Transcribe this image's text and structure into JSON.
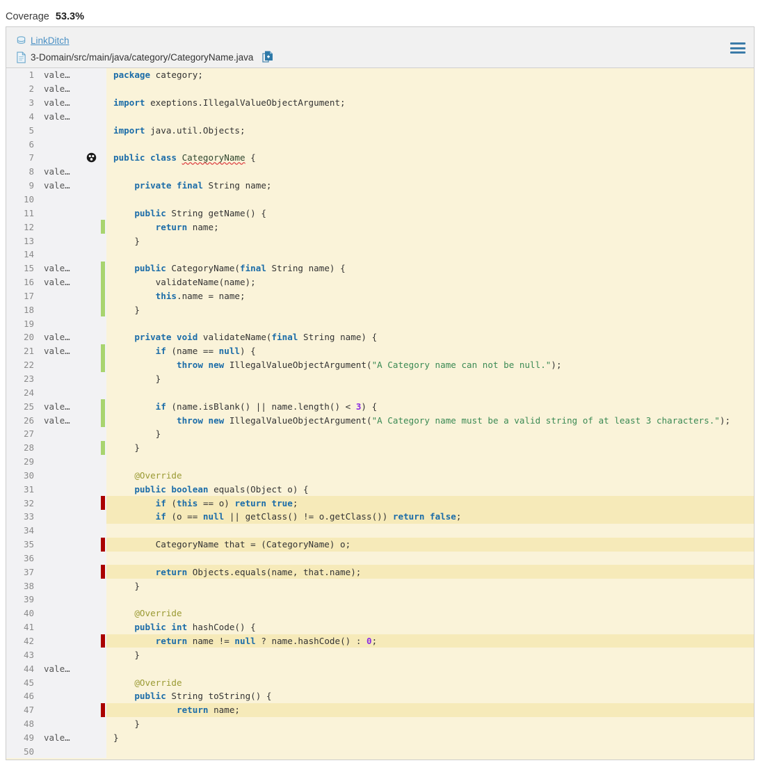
{
  "header": {
    "coverage_label": "Coverage",
    "coverage_value": "53.3%"
  },
  "breadcrumb": {
    "project_icon": "database-icon",
    "project": "LinkDitch",
    "file_icon": "file-icon",
    "file_path": "3-Domain/src/main/java/category/CategoryName.java",
    "copy_icon": "copy-file-icon"
  },
  "toolbar": {
    "menu_icon": "hamburger-menu-icon"
  },
  "editor": {
    "blame_truncated": "vale…",
    "marker_icon": "bug-marker-icon",
    "colors": {
      "covered": "#a8d46f",
      "uncovered": "#aa0000",
      "code_bg": "#faf3d9",
      "uncovered_row_bg": "#f6eab9",
      "gutter_bg": "#f2f2f4",
      "keyword": "#1b6ca8",
      "string": "#3b8a54",
      "number": "#8a2be2",
      "annotation": "#9a9a33",
      "link": "#4a90c4"
    },
    "lines": [
      {
        "n": 1,
        "blame": "vale…",
        "cov": "none",
        "marker": false,
        "uncovered": false,
        "tokens": [
          {
            "t": "package",
            "c": "kw"
          },
          {
            "t": " category;",
            "c": "pl"
          }
        ]
      },
      {
        "n": 2,
        "blame": "vale…",
        "cov": "none",
        "marker": false,
        "uncovered": false,
        "tokens": []
      },
      {
        "n": 3,
        "blame": "vale…",
        "cov": "none",
        "marker": false,
        "uncovered": false,
        "tokens": [
          {
            "t": "import",
            "c": "kw"
          },
          {
            "t": " exeptions.IllegalValueObjectArgument;",
            "c": "pl"
          }
        ]
      },
      {
        "n": 4,
        "blame": "vale…",
        "cov": "none",
        "marker": false,
        "uncovered": false,
        "tokens": []
      },
      {
        "n": 5,
        "blame": "",
        "cov": "none",
        "marker": false,
        "uncovered": false,
        "tokens": [
          {
            "t": "import",
            "c": "kw"
          },
          {
            "t": " java.util.Objects;",
            "c": "pl"
          }
        ]
      },
      {
        "n": 6,
        "blame": "",
        "cov": "none",
        "marker": false,
        "uncovered": false,
        "tokens": []
      },
      {
        "n": 7,
        "blame": "",
        "cov": "none",
        "marker": true,
        "uncovered": false,
        "tokens": [
          {
            "t": "public class",
            "c": "kw"
          },
          {
            "t": " ",
            "c": "pl"
          },
          {
            "t": "CategoryName",
            "c": "err"
          },
          {
            "t": " {",
            "c": "pl"
          }
        ]
      },
      {
        "n": 8,
        "blame": "vale…",
        "cov": "none",
        "marker": false,
        "uncovered": false,
        "tokens": []
      },
      {
        "n": 9,
        "blame": "vale…",
        "cov": "none",
        "marker": false,
        "uncovered": false,
        "tokens": [
          {
            "t": "    ",
            "c": "pl"
          },
          {
            "t": "private final",
            "c": "kw"
          },
          {
            "t": " String name;",
            "c": "pl"
          }
        ]
      },
      {
        "n": 10,
        "blame": "",
        "cov": "none",
        "marker": false,
        "uncovered": false,
        "tokens": []
      },
      {
        "n": 11,
        "blame": "",
        "cov": "none",
        "marker": false,
        "uncovered": false,
        "tokens": [
          {
            "t": "    ",
            "c": "pl"
          },
          {
            "t": "public",
            "c": "kw"
          },
          {
            "t": " String getName() {",
            "c": "pl"
          }
        ]
      },
      {
        "n": 12,
        "blame": "",
        "cov": "green",
        "marker": false,
        "uncovered": false,
        "tokens": [
          {
            "t": "        ",
            "c": "pl"
          },
          {
            "t": "return",
            "c": "kw"
          },
          {
            "t": " name;",
            "c": "pl"
          }
        ]
      },
      {
        "n": 13,
        "blame": "",
        "cov": "none",
        "marker": false,
        "uncovered": false,
        "tokens": [
          {
            "t": "    }",
            "c": "pl"
          }
        ]
      },
      {
        "n": 14,
        "blame": "",
        "cov": "none",
        "marker": false,
        "uncovered": false,
        "tokens": []
      },
      {
        "n": 15,
        "blame": "vale…",
        "cov": "green",
        "marker": false,
        "uncovered": false,
        "tokens": [
          {
            "t": "    ",
            "c": "pl"
          },
          {
            "t": "public",
            "c": "kw"
          },
          {
            "t": " CategoryName(",
            "c": "pl"
          },
          {
            "t": "final",
            "c": "kw"
          },
          {
            "t": " String name) {",
            "c": "pl"
          }
        ]
      },
      {
        "n": 16,
        "blame": "vale…",
        "cov": "green",
        "marker": false,
        "uncovered": false,
        "tokens": [
          {
            "t": "        validateName(name);",
            "c": "pl"
          }
        ]
      },
      {
        "n": 17,
        "blame": "",
        "cov": "green",
        "marker": false,
        "uncovered": false,
        "tokens": [
          {
            "t": "        ",
            "c": "pl"
          },
          {
            "t": "this",
            "c": "kw"
          },
          {
            "t": ".name = name;",
            "c": "pl"
          }
        ]
      },
      {
        "n": 18,
        "blame": "",
        "cov": "green",
        "marker": false,
        "uncovered": false,
        "tokens": [
          {
            "t": "    }",
            "c": "pl"
          }
        ]
      },
      {
        "n": 19,
        "blame": "",
        "cov": "none",
        "marker": false,
        "uncovered": false,
        "tokens": []
      },
      {
        "n": 20,
        "blame": "vale…",
        "cov": "none",
        "marker": false,
        "uncovered": false,
        "tokens": [
          {
            "t": "    ",
            "c": "pl"
          },
          {
            "t": "private void",
            "c": "kw"
          },
          {
            "t": " validateName(",
            "c": "pl"
          },
          {
            "t": "final",
            "c": "kw"
          },
          {
            "t": " String name) {",
            "c": "pl"
          }
        ]
      },
      {
        "n": 21,
        "blame": "vale…",
        "cov": "green",
        "marker": false,
        "uncovered": false,
        "tokens": [
          {
            "t": "        ",
            "c": "pl"
          },
          {
            "t": "if",
            "c": "kw"
          },
          {
            "t": " (name == ",
            "c": "pl"
          },
          {
            "t": "null",
            "c": "kw"
          },
          {
            "t": ") {",
            "c": "pl"
          }
        ]
      },
      {
        "n": 22,
        "blame": "",
        "cov": "green",
        "marker": false,
        "uncovered": false,
        "tokens": [
          {
            "t": "            ",
            "c": "pl"
          },
          {
            "t": "throw new",
            "c": "kw"
          },
          {
            "t": " IllegalValueObjectArgument(",
            "c": "pl"
          },
          {
            "t": "\"A Category name can not be null.\"",
            "c": "str"
          },
          {
            "t": ");",
            "c": "pl"
          }
        ]
      },
      {
        "n": 23,
        "blame": "",
        "cov": "none",
        "marker": false,
        "uncovered": false,
        "tokens": [
          {
            "t": "        }",
            "c": "pl"
          }
        ]
      },
      {
        "n": 24,
        "blame": "",
        "cov": "none",
        "marker": false,
        "uncovered": false,
        "tokens": []
      },
      {
        "n": 25,
        "blame": "vale…",
        "cov": "green",
        "marker": false,
        "uncovered": false,
        "tokens": [
          {
            "t": "        ",
            "c": "pl"
          },
          {
            "t": "if",
            "c": "kw"
          },
          {
            "t": " (name.isBlank() || name.length() < ",
            "c": "pl"
          },
          {
            "t": "3",
            "c": "num"
          },
          {
            "t": ") {",
            "c": "pl"
          }
        ]
      },
      {
        "n": 26,
        "blame": "vale…",
        "cov": "green",
        "marker": false,
        "uncovered": false,
        "tokens": [
          {
            "t": "            ",
            "c": "pl"
          },
          {
            "t": "throw new",
            "c": "kw"
          },
          {
            "t": " IllegalValueObjectArgument(",
            "c": "pl"
          },
          {
            "t": "\"A Category name must be a valid string of at least 3 characters.\"",
            "c": "str"
          },
          {
            "t": ");",
            "c": "pl"
          }
        ]
      },
      {
        "n": 27,
        "blame": "",
        "cov": "none",
        "marker": false,
        "uncovered": false,
        "tokens": [
          {
            "t": "        }",
            "c": "pl"
          }
        ]
      },
      {
        "n": 28,
        "blame": "",
        "cov": "green",
        "marker": false,
        "uncovered": false,
        "tokens": [
          {
            "t": "    }",
            "c": "pl"
          }
        ]
      },
      {
        "n": 29,
        "blame": "",
        "cov": "none",
        "marker": false,
        "uncovered": false,
        "tokens": []
      },
      {
        "n": 30,
        "blame": "",
        "cov": "none",
        "marker": false,
        "uncovered": false,
        "tokens": [
          {
            "t": "    ",
            "c": "pl"
          },
          {
            "t": "@Override",
            "c": "ann"
          }
        ]
      },
      {
        "n": 31,
        "blame": "",
        "cov": "none",
        "marker": false,
        "uncovered": false,
        "tokens": [
          {
            "t": "    ",
            "c": "pl"
          },
          {
            "t": "public boolean",
            "c": "kw"
          },
          {
            "t": " equals(Object o) {",
            "c": "pl"
          }
        ]
      },
      {
        "n": 32,
        "blame": "",
        "cov": "red",
        "marker": false,
        "uncovered": true,
        "tokens": [
          {
            "t": "        ",
            "c": "pl"
          },
          {
            "t": "if",
            "c": "kw"
          },
          {
            "t": " (",
            "c": "pl"
          },
          {
            "t": "this",
            "c": "kw"
          },
          {
            "t": " == o) ",
            "c": "pl"
          },
          {
            "t": "return true",
            "c": "kw"
          },
          {
            "t": ";",
            "c": "pl"
          }
        ]
      },
      {
        "n": 33,
        "blame": "",
        "cov": "none",
        "marker": false,
        "uncovered": true,
        "tokens": [
          {
            "t": "        ",
            "c": "pl"
          },
          {
            "t": "if",
            "c": "kw"
          },
          {
            "t": " (o == ",
            "c": "pl"
          },
          {
            "t": "null",
            "c": "kw"
          },
          {
            "t": " || getClass() != o.getClass()) ",
            "c": "pl"
          },
          {
            "t": "return false",
            "c": "kw"
          },
          {
            "t": ";",
            "c": "pl"
          }
        ]
      },
      {
        "n": 34,
        "blame": "",
        "cov": "none",
        "marker": false,
        "uncovered": false,
        "tokens": []
      },
      {
        "n": 35,
        "blame": "",
        "cov": "red",
        "marker": false,
        "uncovered": true,
        "tokens": [
          {
            "t": "        CategoryName that = (CategoryName) o;",
            "c": "pl"
          }
        ]
      },
      {
        "n": 36,
        "blame": "",
        "cov": "none",
        "marker": false,
        "uncovered": false,
        "tokens": []
      },
      {
        "n": 37,
        "blame": "",
        "cov": "red",
        "marker": false,
        "uncovered": true,
        "tokens": [
          {
            "t": "        ",
            "c": "pl"
          },
          {
            "t": "return",
            "c": "kw"
          },
          {
            "t": " Objects.equals(name, that.name);",
            "c": "pl"
          }
        ]
      },
      {
        "n": 38,
        "blame": "",
        "cov": "none",
        "marker": false,
        "uncovered": false,
        "tokens": [
          {
            "t": "    }",
            "c": "pl"
          }
        ]
      },
      {
        "n": 39,
        "blame": "",
        "cov": "none",
        "marker": false,
        "uncovered": false,
        "tokens": []
      },
      {
        "n": 40,
        "blame": "",
        "cov": "none",
        "marker": false,
        "uncovered": false,
        "tokens": [
          {
            "t": "    ",
            "c": "pl"
          },
          {
            "t": "@Override",
            "c": "ann"
          }
        ]
      },
      {
        "n": 41,
        "blame": "",
        "cov": "none",
        "marker": false,
        "uncovered": false,
        "tokens": [
          {
            "t": "    ",
            "c": "pl"
          },
          {
            "t": "public int",
            "c": "kw"
          },
          {
            "t": " hashCode() {",
            "c": "pl"
          }
        ]
      },
      {
        "n": 42,
        "blame": "",
        "cov": "red",
        "marker": false,
        "uncovered": true,
        "tokens": [
          {
            "t": "        ",
            "c": "pl"
          },
          {
            "t": "return",
            "c": "kw"
          },
          {
            "t": " name != ",
            "c": "pl"
          },
          {
            "t": "null",
            "c": "kw"
          },
          {
            "t": " ? name.hashCode() : ",
            "c": "pl"
          },
          {
            "t": "0",
            "c": "num"
          },
          {
            "t": ";",
            "c": "pl"
          }
        ]
      },
      {
        "n": 43,
        "blame": "",
        "cov": "none",
        "marker": false,
        "uncovered": false,
        "tokens": [
          {
            "t": "    }",
            "c": "pl"
          }
        ]
      },
      {
        "n": 44,
        "blame": "vale…",
        "cov": "none",
        "marker": false,
        "uncovered": false,
        "tokens": []
      },
      {
        "n": 45,
        "blame": "",
        "cov": "none",
        "marker": false,
        "uncovered": false,
        "tokens": [
          {
            "t": "    ",
            "c": "pl"
          },
          {
            "t": "@Override",
            "c": "ann"
          }
        ]
      },
      {
        "n": 46,
        "blame": "",
        "cov": "none",
        "marker": false,
        "uncovered": false,
        "tokens": [
          {
            "t": "    ",
            "c": "pl"
          },
          {
            "t": "public",
            "c": "kw"
          },
          {
            "t": " String toString() {",
            "c": "pl"
          }
        ]
      },
      {
        "n": 47,
        "blame": "",
        "cov": "red",
        "marker": false,
        "uncovered": true,
        "tokens": [
          {
            "t": "            ",
            "c": "pl"
          },
          {
            "t": "return",
            "c": "kw"
          },
          {
            "t": " name;",
            "c": "pl"
          }
        ]
      },
      {
        "n": 48,
        "blame": "",
        "cov": "none",
        "marker": false,
        "uncovered": false,
        "tokens": [
          {
            "t": "    }",
            "c": "pl"
          }
        ]
      },
      {
        "n": 49,
        "blame": "vale…",
        "cov": "none",
        "marker": false,
        "uncovered": false,
        "tokens": [
          {
            "t": "}",
            "c": "pl"
          }
        ]
      },
      {
        "n": 50,
        "blame": "",
        "cov": "none",
        "marker": false,
        "uncovered": false,
        "tokens": []
      }
    ]
  }
}
